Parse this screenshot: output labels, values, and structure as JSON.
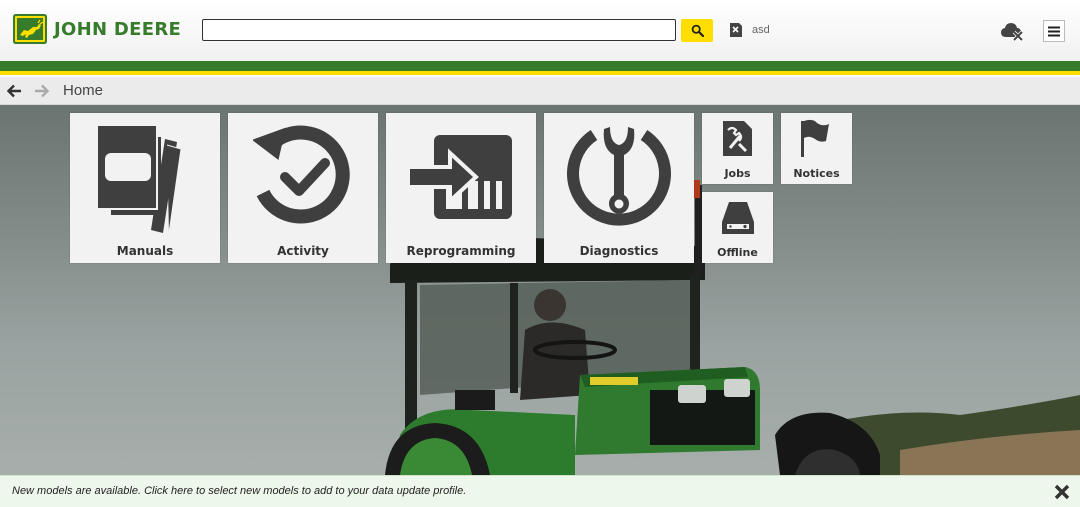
{
  "header": {
    "brand": "JOHN DEERE",
    "search": {
      "value": "",
      "placeholder": ""
    },
    "user": {
      "name": "asd"
    }
  },
  "nav": {
    "breadcrumb": "Home"
  },
  "tiles": [
    {
      "label": "Manuals",
      "icon": "manuals-icon"
    },
    {
      "label": "Activity",
      "icon": "activity-icon"
    },
    {
      "label": "Reprogramming",
      "icon": "reprogramming-icon"
    },
    {
      "label": "Diagnostics",
      "icon": "diagnostics-icon"
    },
    {
      "label": "Jobs",
      "icon": "jobs-icon"
    },
    {
      "label": "Notices",
      "icon": "notices-icon"
    },
    {
      "label": "Offline",
      "icon": "offline-icon"
    }
  ],
  "notification": {
    "text": "New models are available. Click here to select new models to add to your data update profile."
  },
  "colors": {
    "brand_green": "#367c2b",
    "brand_yellow": "#ffde00",
    "tile_bg": "#f2f2f2",
    "icon_gray": "#3f3f3f"
  }
}
